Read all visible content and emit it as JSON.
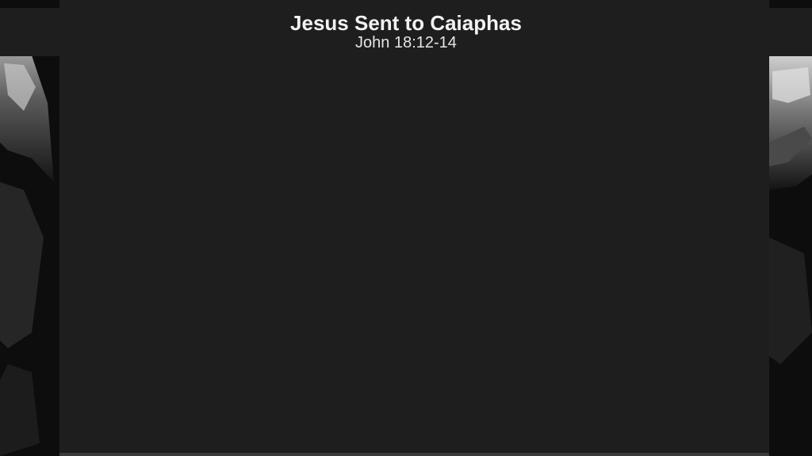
{
  "slide": {
    "title": "Jesus Sent to Caiaphas",
    "subtitle": "John 18:12-14"
  },
  "colors": {
    "panel": "#1e1e1e",
    "text": "#f2f2f2",
    "edge_dark": "#0f0f0f"
  }
}
